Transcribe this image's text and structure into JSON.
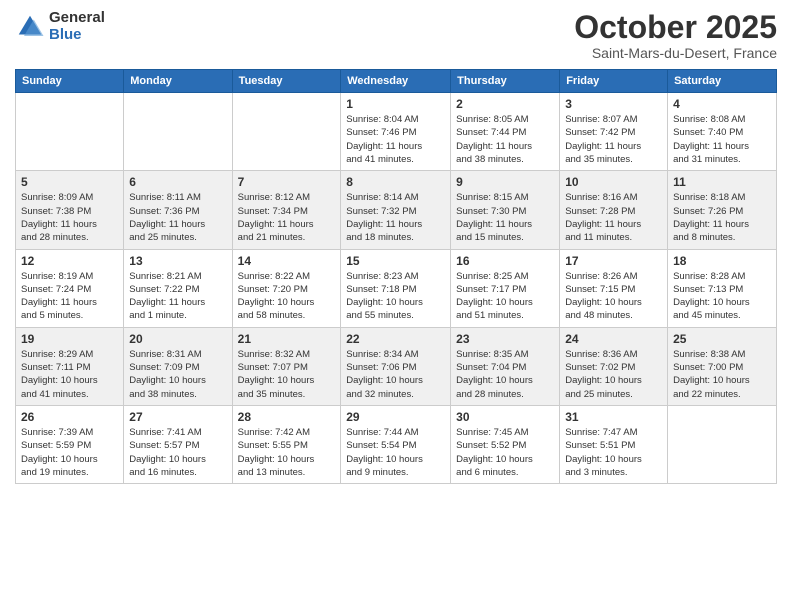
{
  "logo": {
    "general": "General",
    "blue": "Blue"
  },
  "header": {
    "month": "October 2025",
    "location": "Saint-Mars-du-Desert, France"
  },
  "weekdays": [
    "Sunday",
    "Monday",
    "Tuesday",
    "Wednesday",
    "Thursday",
    "Friday",
    "Saturday"
  ],
  "weeks": [
    [
      {
        "day": "",
        "info": ""
      },
      {
        "day": "",
        "info": ""
      },
      {
        "day": "",
        "info": ""
      },
      {
        "day": "1",
        "info": "Sunrise: 8:04 AM\nSunset: 7:46 PM\nDaylight: 11 hours\nand 41 minutes."
      },
      {
        "day": "2",
        "info": "Sunrise: 8:05 AM\nSunset: 7:44 PM\nDaylight: 11 hours\nand 38 minutes."
      },
      {
        "day": "3",
        "info": "Sunrise: 8:07 AM\nSunset: 7:42 PM\nDaylight: 11 hours\nand 35 minutes."
      },
      {
        "day": "4",
        "info": "Sunrise: 8:08 AM\nSunset: 7:40 PM\nDaylight: 11 hours\nand 31 minutes."
      }
    ],
    [
      {
        "day": "5",
        "info": "Sunrise: 8:09 AM\nSunset: 7:38 PM\nDaylight: 11 hours\nand 28 minutes."
      },
      {
        "day": "6",
        "info": "Sunrise: 8:11 AM\nSunset: 7:36 PM\nDaylight: 11 hours\nand 25 minutes."
      },
      {
        "day": "7",
        "info": "Sunrise: 8:12 AM\nSunset: 7:34 PM\nDaylight: 11 hours\nand 21 minutes."
      },
      {
        "day": "8",
        "info": "Sunrise: 8:14 AM\nSunset: 7:32 PM\nDaylight: 11 hours\nand 18 minutes."
      },
      {
        "day": "9",
        "info": "Sunrise: 8:15 AM\nSunset: 7:30 PM\nDaylight: 11 hours\nand 15 minutes."
      },
      {
        "day": "10",
        "info": "Sunrise: 8:16 AM\nSunset: 7:28 PM\nDaylight: 11 hours\nand 11 minutes."
      },
      {
        "day": "11",
        "info": "Sunrise: 8:18 AM\nSunset: 7:26 PM\nDaylight: 11 hours\nand 8 minutes."
      }
    ],
    [
      {
        "day": "12",
        "info": "Sunrise: 8:19 AM\nSunset: 7:24 PM\nDaylight: 11 hours\nand 5 minutes."
      },
      {
        "day": "13",
        "info": "Sunrise: 8:21 AM\nSunset: 7:22 PM\nDaylight: 11 hours\nand 1 minute."
      },
      {
        "day": "14",
        "info": "Sunrise: 8:22 AM\nSunset: 7:20 PM\nDaylight: 10 hours\nand 58 minutes."
      },
      {
        "day": "15",
        "info": "Sunrise: 8:23 AM\nSunset: 7:18 PM\nDaylight: 10 hours\nand 55 minutes."
      },
      {
        "day": "16",
        "info": "Sunrise: 8:25 AM\nSunset: 7:17 PM\nDaylight: 10 hours\nand 51 minutes."
      },
      {
        "day": "17",
        "info": "Sunrise: 8:26 AM\nSunset: 7:15 PM\nDaylight: 10 hours\nand 48 minutes."
      },
      {
        "day": "18",
        "info": "Sunrise: 8:28 AM\nSunset: 7:13 PM\nDaylight: 10 hours\nand 45 minutes."
      }
    ],
    [
      {
        "day": "19",
        "info": "Sunrise: 8:29 AM\nSunset: 7:11 PM\nDaylight: 10 hours\nand 41 minutes."
      },
      {
        "day": "20",
        "info": "Sunrise: 8:31 AM\nSunset: 7:09 PM\nDaylight: 10 hours\nand 38 minutes."
      },
      {
        "day": "21",
        "info": "Sunrise: 8:32 AM\nSunset: 7:07 PM\nDaylight: 10 hours\nand 35 minutes."
      },
      {
        "day": "22",
        "info": "Sunrise: 8:34 AM\nSunset: 7:06 PM\nDaylight: 10 hours\nand 32 minutes."
      },
      {
        "day": "23",
        "info": "Sunrise: 8:35 AM\nSunset: 7:04 PM\nDaylight: 10 hours\nand 28 minutes."
      },
      {
        "day": "24",
        "info": "Sunrise: 8:36 AM\nSunset: 7:02 PM\nDaylight: 10 hours\nand 25 minutes."
      },
      {
        "day": "25",
        "info": "Sunrise: 8:38 AM\nSunset: 7:00 PM\nDaylight: 10 hours\nand 22 minutes."
      }
    ],
    [
      {
        "day": "26",
        "info": "Sunrise: 7:39 AM\nSunset: 5:59 PM\nDaylight: 10 hours\nand 19 minutes."
      },
      {
        "day": "27",
        "info": "Sunrise: 7:41 AM\nSunset: 5:57 PM\nDaylight: 10 hours\nand 16 minutes."
      },
      {
        "day": "28",
        "info": "Sunrise: 7:42 AM\nSunset: 5:55 PM\nDaylight: 10 hours\nand 13 minutes."
      },
      {
        "day": "29",
        "info": "Sunrise: 7:44 AM\nSunset: 5:54 PM\nDaylight: 10 hours\nand 9 minutes."
      },
      {
        "day": "30",
        "info": "Sunrise: 7:45 AM\nSunset: 5:52 PM\nDaylight: 10 hours\nand 6 minutes."
      },
      {
        "day": "31",
        "info": "Sunrise: 7:47 AM\nSunset: 5:51 PM\nDaylight: 10 hours\nand 3 minutes."
      },
      {
        "day": "",
        "info": ""
      }
    ]
  ]
}
